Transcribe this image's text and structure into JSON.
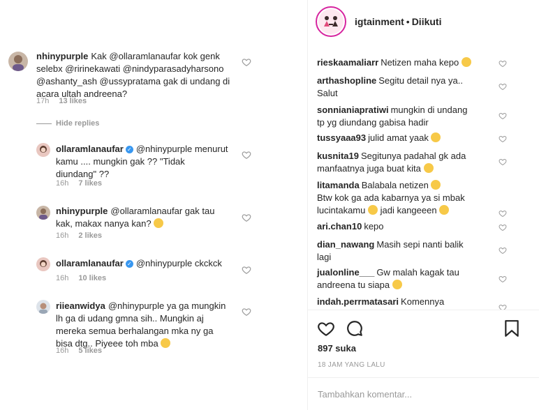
{
  "post": {
    "account": "igtainment",
    "separator": "•",
    "follow_status": "Diikuti",
    "likes": "897 suka",
    "timestamp": "18 JAM YANG LALU",
    "add_comment_placeholder": "Tambahkan komentar..."
  },
  "thread": {
    "main": {
      "user": "nhinypurple",
      "line1": "Kak @ollaramlanaufar kok genk",
      "line2": "selebx @ririnekawati @nindyparasadyharsono",
      "line3": "@ashanty_ash @ussypratama gak di undang di",
      "line4": "acara ultah andreena?",
      "time": "17h",
      "likes": "13 likes"
    },
    "hide_replies": "Hide replies",
    "replies": [
      {
        "user": "ollaramlanaufar",
        "verified": true,
        "line1": "@nhinypurple menurut",
        "line2": "kamu .... mungkin gak ?? \"Tidak",
        "line3": "diundang\" ??",
        "time": "16h",
        "likes": "7 likes"
      },
      {
        "user": "nhinypurple",
        "line1": "@ollaramlanaufar gak tau",
        "line2": "kak, makax nanya kan?",
        "time": "16h",
        "likes": "2 likes"
      },
      {
        "user": "ollaramlanaufar",
        "verified": true,
        "line1": "@nhinypurple ckckck",
        "time": "16h",
        "likes": "10 likes"
      },
      {
        "user": "riieanwidya",
        "line1": "@nhinypurple ya ga mungkin",
        "line2": "lh ga di udang gmna sih.. Mungkin aj",
        "line3": "mereka semua berhalangan mka ny ga",
        "line4": "bisa dtg.. Piyeee toh mba",
        "time": "16h",
        "likes": "5 likes"
      }
    ]
  },
  "comments": [
    {
      "user": "rieskaamaliarr",
      "line1": "Netizen maha kepo"
    },
    {
      "user": "arthashopline",
      "line1": "Segitu detail nya ya..",
      "line2": "Salut"
    },
    {
      "user": "sonnianiapratiwi",
      "line1": "mungkin di undang",
      "line2": "tp yg diundang gabisa hadir"
    },
    {
      "user": "tussyaaa93",
      "line1": "julid amat yaak"
    },
    {
      "user": "kusnita19",
      "line1": "Segitunya padahal gk ada",
      "line2": "manfaatnya juga buat kita"
    },
    {
      "user": "litamanda",
      "line1": "Balabala netizen",
      "line2": "Btw kok ga ada kabarnya ya si mbak",
      "line3": "lucintakamu",
      "line3b": "jadi kangeeen"
    },
    {
      "user": "ari.chan10",
      "line1": "kepo"
    },
    {
      "user": "dian_nawang",
      "line1": "Masih sepi nanti balik",
      "line2": "lagi"
    },
    {
      "user": "jualonline___",
      "line1": "Gw malah kagak tau",
      "line2": "andreena tu siapa"
    },
    {
      "user": "indah.perrmatasari",
      "line1": "Komennya"
    }
  ],
  "colors": {
    "verified": "#3897f0",
    "muted": "#999999",
    "text": "#262626",
    "border": "#efefef",
    "story_ring": "#d6249f"
  },
  "icons": [
    "heart-icon",
    "comment-icon",
    "bookmark-icon",
    "verified-badge-icon",
    "emoji-icon"
  ]
}
